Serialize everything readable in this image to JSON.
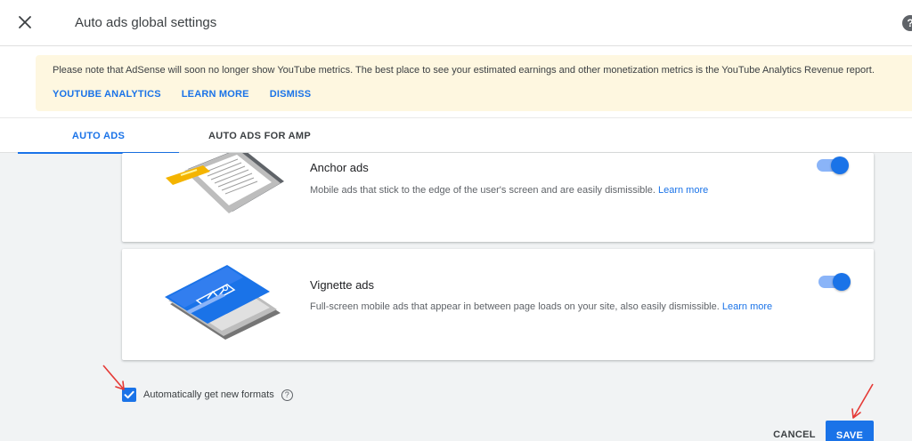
{
  "header": {
    "title": "Auto ads global settings",
    "help_glyph": "?"
  },
  "banner": {
    "message": "Please note that AdSense will soon no longer show YouTube metrics. The best place to see your estimated earnings and other monetization metrics is the YouTube Analytics Revenue report.",
    "links": [
      "YOUTUBE ANALYTICS",
      "LEARN MORE",
      "DISMISS"
    ]
  },
  "tabs": [
    {
      "label": "AUTO ADS",
      "active": true
    },
    {
      "label": "AUTO ADS FOR AMP",
      "active": false
    }
  ],
  "cards": [
    {
      "title": "Anchor ads",
      "description": "Mobile ads that stick to the edge of the user's screen and are easily dismissible.",
      "link": "Learn more",
      "enabled": true
    },
    {
      "title": "Vignette ads",
      "description": "Full-screen mobile ads that appear in between page loads on your site, also easily dismissible.",
      "link": "Learn more",
      "enabled": true
    }
  ],
  "auto_formats": {
    "label": "Automatically get new formats",
    "checked": true,
    "help_glyph": "?"
  },
  "actions": {
    "cancel": "CANCEL",
    "save": "SAVE"
  },
  "colors": {
    "accent": "#1a73e8",
    "banner_bg": "#fef7e0",
    "annotation_arrow": "#e53935"
  },
  "icons": [
    "close-icon",
    "help-icon",
    "checkmark-icon",
    "question-circle-icon"
  ]
}
